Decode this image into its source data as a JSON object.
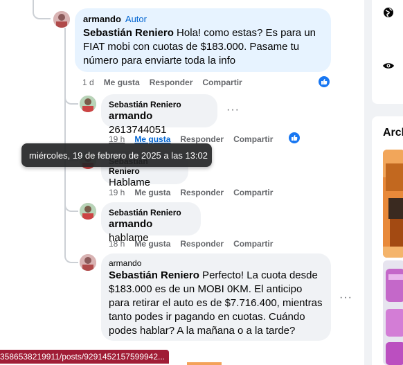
{
  "comments": [
    {
      "author": "armando",
      "author_badge": "Autor",
      "mention": "Sebastián Reniero",
      "text": " Hola! como estas? Es para un FIAT mobi con cuotas de $183.000. Pasame tu número para enviarte toda la info",
      "time": "1 d",
      "like": "Me gusta",
      "reply": "Responder",
      "share": "Compartir"
    },
    {
      "author": "Sebastián Reniero",
      "mention": "armando",
      "text": " 2613744051",
      "time": "19 h",
      "like": "Me gusta",
      "reply": "Responder",
      "share": "Compartir"
    },
    {
      "author": "Sebastián Reniero",
      "text": "Hablame",
      "time": "19 h",
      "like": "Me gusta",
      "reply": "Responder",
      "share": "Compartir"
    },
    {
      "author": "Sebastián Reniero",
      "mention": "armando",
      "text": " hablame",
      "time": "18 h",
      "like": "Me gusta",
      "reply": "Responder",
      "share": "Compartir"
    },
    {
      "author": "armando",
      "mention": "Sebastián Reniero",
      "text": " Perfecto! La cuota desde $183.000 es de un MOBI 0KM. El anticipo para retirar el auto es de $7.716.400, mientras tanto podes ir pagando en cuotas. Cuándo podes hablar? A la mañana o a la tarde?"
    }
  ],
  "tooltip": "miércoles, 19 de febrero de 2025 a las 13:02",
  "status_url": "3586538219911/posts/9291452157599942...",
  "sidebar": {
    "section_title": "Arch",
    "icons": [
      "globe-icon",
      "eye-icon"
    ]
  },
  "colors": {
    "accent": "#0064d1",
    "like_blue": "#1877f2",
    "bubble": "#f0f2f5",
    "bubble_highlight": "#e7f3ff",
    "statusbar": "#a01d36"
  }
}
